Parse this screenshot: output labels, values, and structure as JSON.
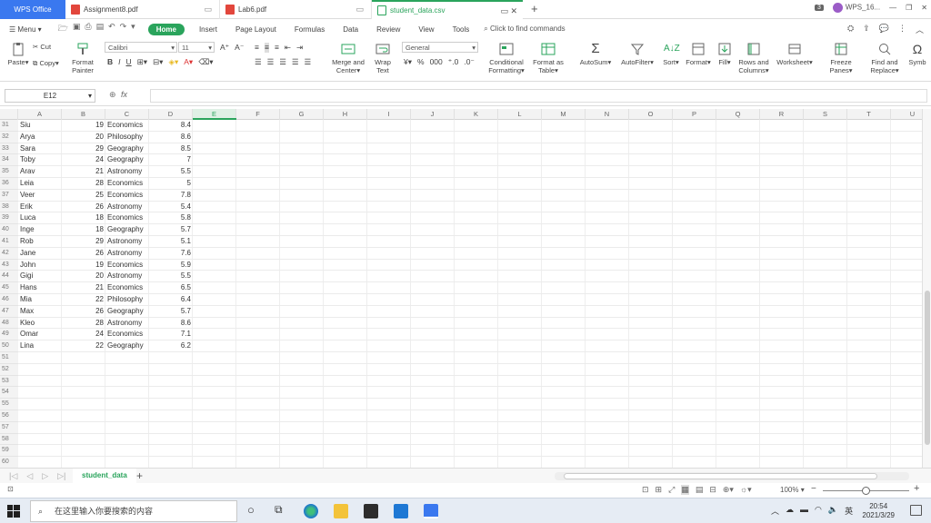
{
  "titlebar": {
    "app_tab": "WPS Office",
    "tabs": [
      {
        "label": "Assignment8.pdf"
      },
      {
        "label": "Lab6.pdf"
      },
      {
        "label": "student_data.csv"
      }
    ],
    "window_count": "3",
    "user": "WPS_16..."
  },
  "menubar": {
    "menu": "Menu",
    "items": [
      "Home",
      "Insert",
      "Page Layout",
      "Formulas",
      "Data",
      "Review",
      "View",
      "Tools"
    ],
    "find": "Click to find commands"
  },
  "ribbon": {
    "cut": "Cut",
    "copy": "Copy",
    "paste": "Paste",
    "format_painter": [
      "Format",
      "Painter"
    ],
    "font": "Calibri",
    "size": "11",
    "merge": [
      "Merge and",
      "Center"
    ],
    "wrap": [
      "Wrap",
      "Text"
    ],
    "number_format": "General",
    "conditional": [
      "Conditional",
      "Formatting"
    ],
    "format_table": [
      "Format as",
      "Table"
    ],
    "autosum": "AutoSum",
    "autofilter": "AutoFilter",
    "sort": "Sort",
    "format": "Format",
    "fill": "Fill",
    "rows_cols": [
      "Rows and",
      "Columns"
    ],
    "worksheet": "Worksheet",
    "freeze": "Freeze Panes",
    "find_replace": [
      "Find and",
      "Replace"
    ],
    "symbol": "Symb"
  },
  "formula_bar": {
    "name_box": "E12",
    "fx": "fx",
    "value": ""
  },
  "columns": [
    "A",
    "B",
    "C",
    "D",
    "E",
    "F",
    "G",
    "H",
    "I",
    "J",
    "K",
    "L",
    "M",
    "N",
    "O",
    "P",
    "Q",
    "R",
    "S",
    "T",
    "U"
  ],
  "rows": [
    {
      "n": "31",
      "a": "Siu",
      "b": "19",
      "c": "Economics",
      "d": "8.4"
    },
    {
      "n": "32",
      "a": "Arya",
      "b": "20",
      "c": "Philosophy",
      "d": "8.6"
    },
    {
      "n": "33",
      "a": "Sara",
      "b": "29",
      "c": "Geography",
      "d": "8.5"
    },
    {
      "n": "34",
      "a": "Toby",
      "b": "24",
      "c": "Geography",
      "d": "7"
    },
    {
      "n": "35",
      "a": "Arav",
      "b": "21",
      "c": "Astronomy",
      "d": "5.5"
    },
    {
      "n": "36",
      "a": "Leia",
      "b": "28",
      "c": "Economics",
      "d": "5"
    },
    {
      "n": "37",
      "a": "Veer",
      "b": "25",
      "c": "Economics",
      "d": "7.8"
    },
    {
      "n": "38",
      "a": "Erik",
      "b": "26",
      "c": "Astronomy",
      "d": "5.4"
    },
    {
      "n": "39",
      "a": "Luca",
      "b": "18",
      "c": "Economics",
      "d": "5.8"
    },
    {
      "n": "40",
      "a": "Inge",
      "b": "18",
      "c": "Geography",
      "d": "5.7"
    },
    {
      "n": "41",
      "a": "Rob",
      "b": "29",
      "c": "Astronomy",
      "d": "5.1"
    },
    {
      "n": "42",
      "a": "Jane",
      "b": "26",
      "c": "Astronomy",
      "d": "7.6"
    },
    {
      "n": "43",
      "a": "John",
      "b": "19",
      "c": "Economics",
      "d": "5.9"
    },
    {
      "n": "44",
      "a": "Gigi",
      "b": "20",
      "c": "Astronomy",
      "d": "5.5"
    },
    {
      "n": "45",
      "a": "Hans",
      "b": "21",
      "c": "Economics",
      "d": "6.5"
    },
    {
      "n": "46",
      "a": "Mia",
      "b": "22",
      "c": "Philosophy",
      "d": "6.4"
    },
    {
      "n": "47",
      "a": "Max",
      "b": "26",
      "c": "Geography",
      "d": "5.7"
    },
    {
      "n": "48",
      "a": "Kleo",
      "b": "28",
      "c": "Astronomy",
      "d": "8.6"
    },
    {
      "n": "49",
      "a": "Omar",
      "b": "24",
      "c": "Economics",
      "d": "7.1"
    },
    {
      "n": "50",
      "a": "Lina",
      "b": "22",
      "c": "Geography",
      "d": "6.2"
    },
    {
      "n": "51",
      "a": "",
      "b": "",
      "c": "",
      "d": ""
    },
    {
      "n": "52",
      "a": "",
      "b": "",
      "c": "",
      "d": ""
    },
    {
      "n": "53",
      "a": "",
      "b": "",
      "c": "",
      "d": ""
    },
    {
      "n": "54",
      "a": "",
      "b": "",
      "c": "",
      "d": ""
    },
    {
      "n": "55",
      "a": "",
      "b": "",
      "c": "",
      "d": ""
    },
    {
      "n": "56",
      "a": "",
      "b": "",
      "c": "",
      "d": ""
    },
    {
      "n": "57",
      "a": "",
      "b": "",
      "c": "",
      "d": ""
    },
    {
      "n": "58",
      "a": "",
      "b": "",
      "c": "",
      "d": ""
    },
    {
      "n": "59",
      "a": "",
      "b": "",
      "c": "",
      "d": ""
    },
    {
      "n": "60",
      "a": "",
      "b": "",
      "c": "",
      "d": ""
    }
  ],
  "sheet_tab": "student_data",
  "status": {
    "zoom": "100%"
  },
  "taskbar": {
    "search_placeholder": "在这里输入你要搜索的内容",
    "ime": "英",
    "time": "20:54",
    "date": "2021/3/29"
  },
  "colors": {
    "accent": "#2aa45c",
    "wps_blue": "#3a78ef",
    "pdf_red": "#e2463c"
  }
}
